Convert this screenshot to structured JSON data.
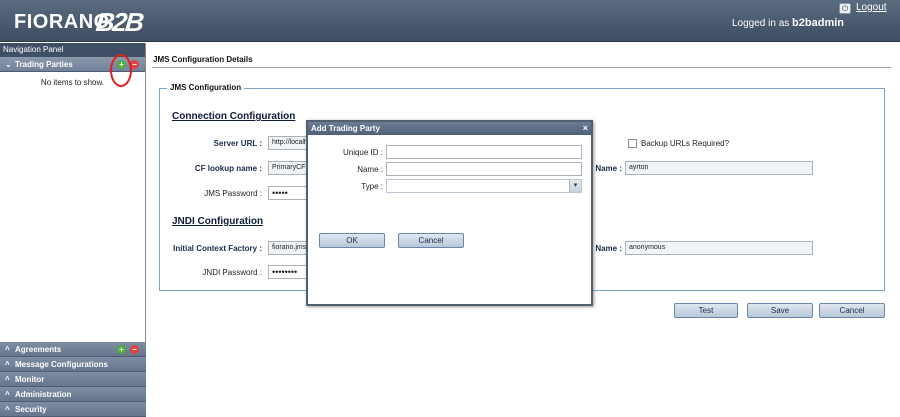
{
  "header": {
    "logo_text": "FIORANO",
    "logo_mark": "B2B",
    "logout_label": "Logout",
    "logged_in_prefix": "Logged in as",
    "username": "b2badmin"
  },
  "sidebar": {
    "title": "Navigation Panel",
    "active_section": "Trading Parties",
    "empty_text": "No items to show.",
    "sections": [
      "Agreements",
      "Message Configurations",
      "Monitor",
      "Administration",
      "Security"
    ]
  },
  "main": {
    "title": "JMS Configuration Details",
    "fieldset_legend": "JMS Configuration",
    "connection": {
      "title": "Connection Configuration",
      "server_url_label": "Server URL :",
      "server_url_value": "http://localh",
      "backup_label": "Backup URLs Required?",
      "cf_lookup_label": "CF lookup name :",
      "cf_lookup_value": "PrimaryCF",
      "user_name_label": "Name :",
      "user_name_value": "ayrton",
      "jms_password_label": "JMS Password :",
      "jms_password_value": "•••••"
    },
    "jndi": {
      "title": "JNDI Configuration",
      "icf_label": "Initial Context Factory :",
      "icf_value": "fiorano.jms",
      "principal_label": "Name :",
      "principal_value": "anonymous",
      "password_label": "JNDI Password :",
      "password_value": "••••••••"
    },
    "buttons": {
      "test": "Test",
      "save": "Save",
      "cancel": "Cancel"
    }
  },
  "dialog": {
    "title": "Add Trading Party",
    "close": "×",
    "unique_id_label": "Unique ID :",
    "name_label": "Name :",
    "type_label": "Type :",
    "ok": "OK",
    "cancel": "Cancel"
  },
  "colors": {
    "header_bg": "#4a5a70",
    "accordion_bg": "#6f7f95",
    "fieldset_border": "#7da4c9",
    "highlight_circle": "#e0201e"
  }
}
